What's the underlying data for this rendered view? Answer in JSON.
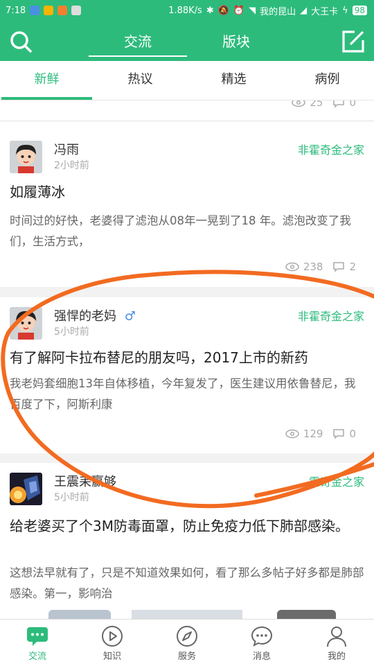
{
  "status_bar": {
    "time": "7:18",
    "speed": "1.88K/s",
    "carrier1": "我的昆山",
    "carrier2": "大王卡",
    "battery": "98"
  },
  "header": {
    "tabs": [
      "交流",
      "版块"
    ],
    "active_tab": "交流",
    "search_icon": "search-icon",
    "edit_icon": "edit-icon"
  },
  "sub_tabs": [
    "新鲜",
    "热议",
    "精选",
    "病例"
  ],
  "feed": {
    "partial_stats": {
      "views": "25",
      "comments": "0"
    },
    "posts": [
      {
        "author": "冯雨",
        "time": "2小时前",
        "tag": "非霍奇金之家",
        "title": "如履薄冰",
        "excerpt": "时间过的好快，老婆得了滤泡从08年一晃到了18  年。滤泡改变了我们，生活方式，",
        "views": "238",
        "comments": "2"
      },
      {
        "author": "强悍的老妈",
        "gender": "♂",
        "time": "5小时前",
        "tag": "非霍奇金之家",
        "title": "有了解阿卡拉布替尼的朋友吗，2017上市的新药",
        "excerpt": "我老妈套细胞13年自体移植，今年复发了，医生建议用依鲁替尼，我百度了下，阿斯利康",
        "views": "129",
        "comments": "0"
      },
      {
        "author": "王震耒赢够",
        "time": "5小时前",
        "tag": "霍奇金之家",
        "title": "给老婆买了个3M防毒面罩，防止免疫力低下肺部感染。",
        "excerpt": "这想法早就有了，只是不知道效果如何，看了那么多帖子好多都是肺部感染。第一，影响治"
      }
    ]
  },
  "bottom_nav": [
    {
      "label": "交流",
      "icon": "chat-bubble-icon"
    },
    {
      "label": "知识",
      "icon": "play-circle-icon"
    },
    {
      "label": "服务",
      "icon": "compass-icon"
    },
    {
      "label": "消息",
      "icon": "message-icon"
    },
    {
      "label": "我的",
      "icon": "person-icon"
    }
  ],
  "colors": {
    "accent": "#2dbb7c",
    "annotation": "#f26b21"
  }
}
